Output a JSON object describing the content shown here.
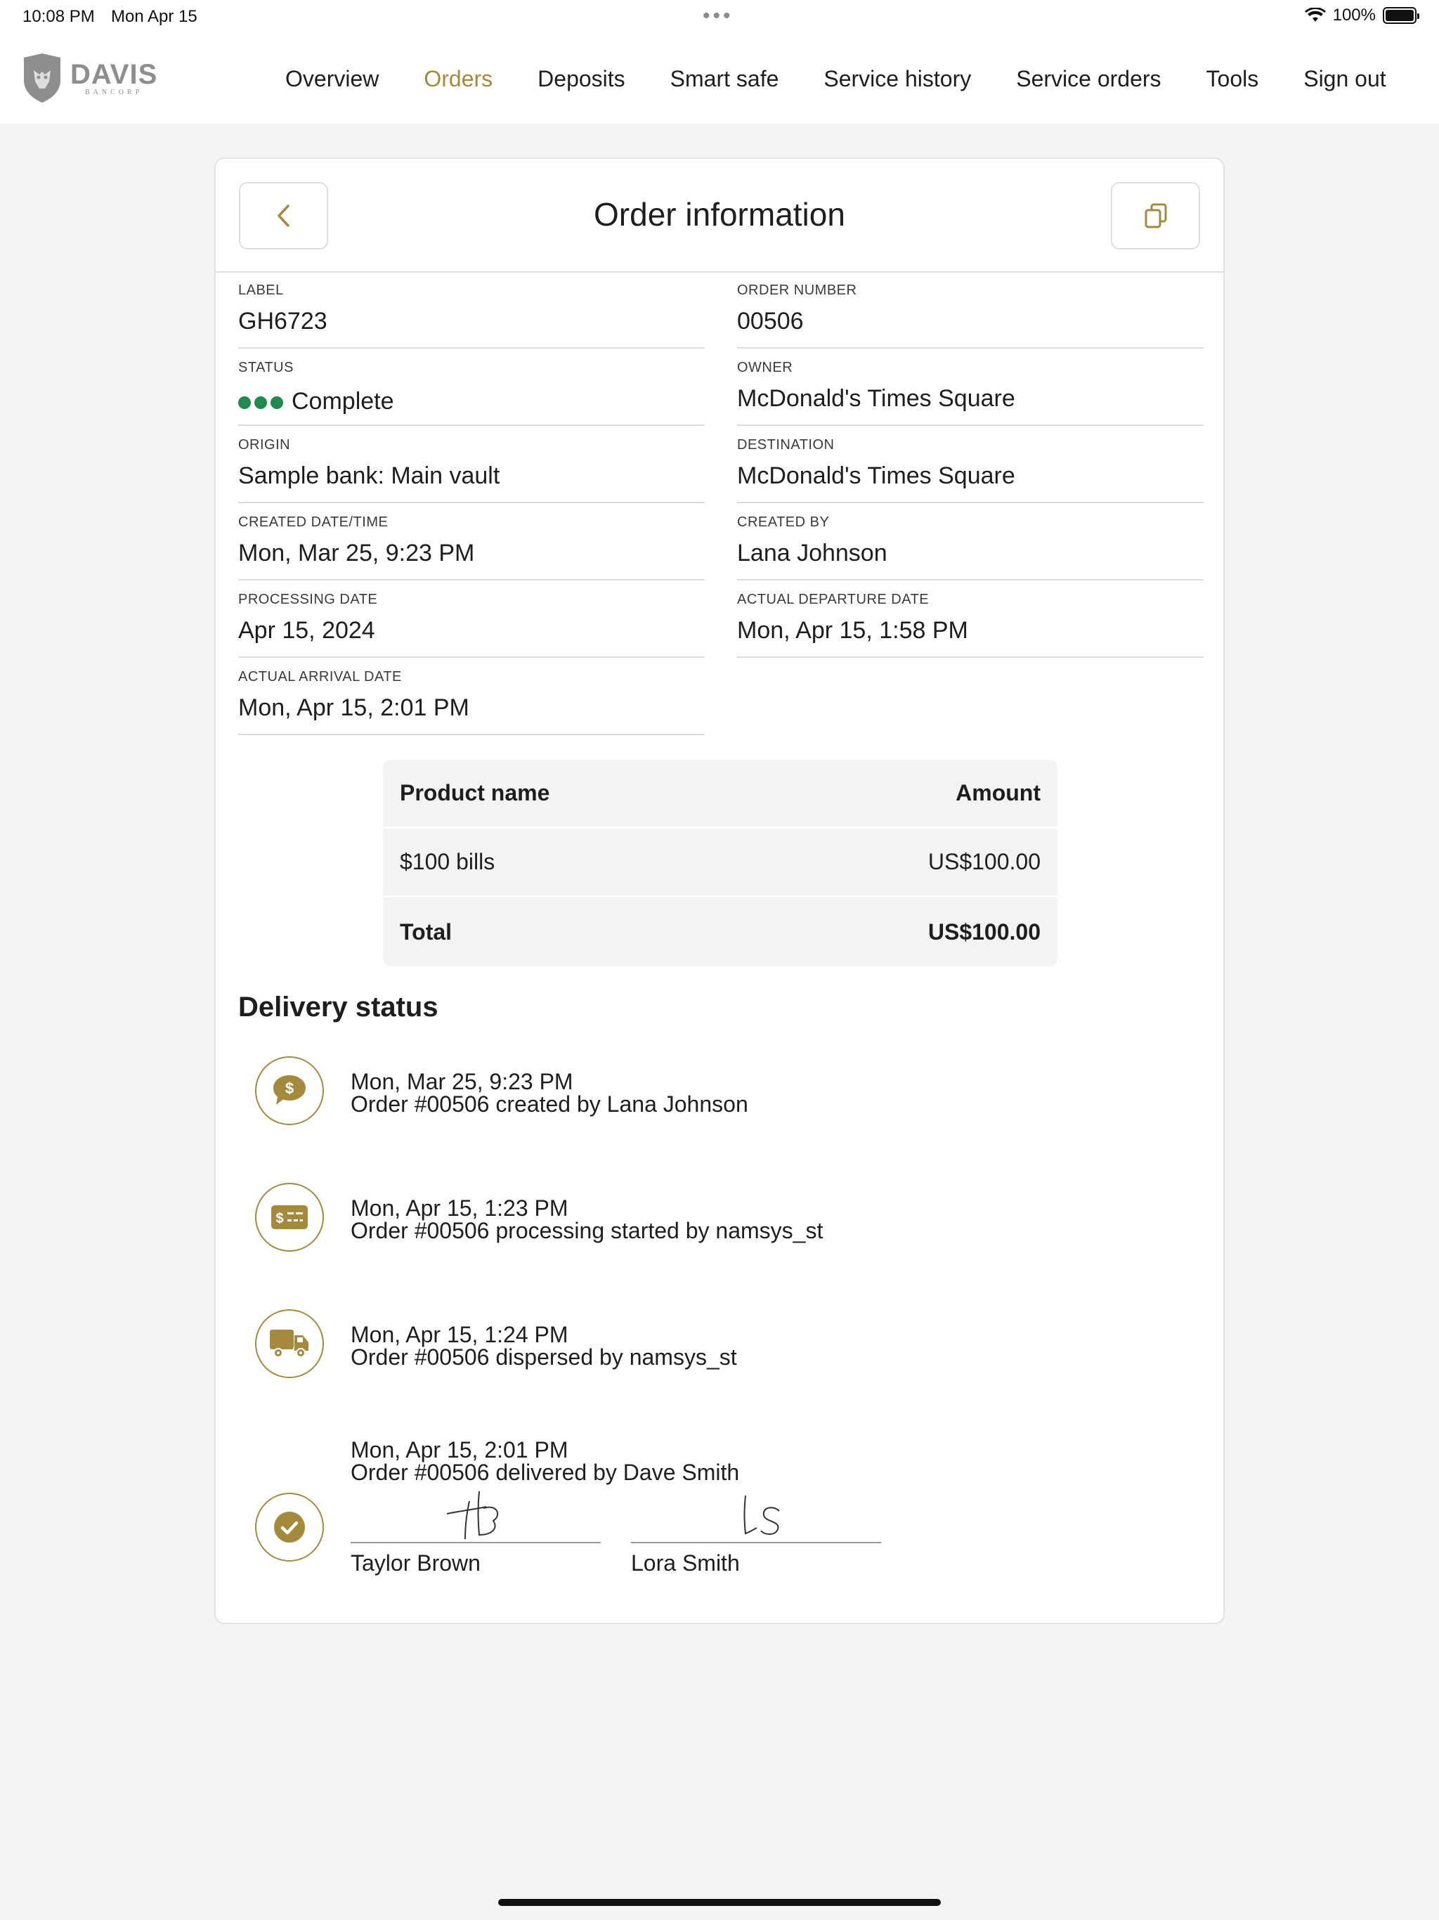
{
  "status_bar": {
    "time": "10:08 PM",
    "date": "Mon Apr 15",
    "battery": "100%"
  },
  "brand": {
    "name": "DAVIS",
    "sub": "BANCORP"
  },
  "nav": {
    "items": [
      "Overview",
      "Orders",
      "Deposits",
      "Smart safe",
      "Service history",
      "Service orders",
      "Tools",
      "Sign out"
    ],
    "active": "Orders"
  },
  "colors": {
    "accent": "#a48a3d",
    "status_green": "#1f8a4c"
  },
  "order": {
    "title": "Order information",
    "fields": {
      "label": {
        "label": "LABEL",
        "value": "GH6723"
      },
      "order_number": {
        "label": "ORDER NUMBER",
        "value": "00506"
      },
      "status": {
        "label": "STATUS",
        "value": "Complete"
      },
      "owner": {
        "label": "OWNER",
        "value": "McDonald's Times Square"
      },
      "origin": {
        "label": "ORIGIN",
        "value": "Sample bank: Main vault"
      },
      "destination": {
        "label": "DESTINATION",
        "value": "McDonald's Times Square"
      },
      "created_datetime": {
        "label": "CREATED DATE/TIME",
        "value": "Mon, Mar 25, 9:23 PM"
      },
      "created_by": {
        "label": "CREATED BY",
        "value": "Lana Johnson"
      },
      "processing_date": {
        "label": "PROCESSING DATE",
        "value": "Apr 15, 2024"
      },
      "actual_departure": {
        "label": "ACTUAL DEPARTURE DATE",
        "value": "Mon, Apr 15, 1:58 PM"
      },
      "actual_arrival": {
        "label": "ACTUAL ARRIVAL DATE",
        "value": "Mon, Apr 15, 2:01 PM"
      }
    }
  },
  "products": {
    "headers": {
      "name": "Product name",
      "amount": "Amount"
    },
    "rows": [
      {
        "name": "$100 bills",
        "amount": "US$100.00"
      }
    ],
    "total": {
      "label": "Total",
      "amount": "US$100.00"
    }
  },
  "delivery": {
    "title": "Delivery status",
    "events": [
      {
        "icon": "money-chat-icon",
        "date": "Mon, Mar 25, 9:23 PM",
        "text": "Order #00506 created by Lana Johnson"
      },
      {
        "icon": "cash-card-icon",
        "date": "Mon, Apr 15, 1:23 PM",
        "text": "Order #00506 processing started by namsys_st"
      },
      {
        "icon": "truck-icon",
        "date": "Mon, Apr 15, 1:24 PM",
        "text": "Order #00506 dispersed by namsys_st"
      },
      {
        "icon": "check-circle-icon",
        "date": "Mon, Apr 15, 2:01 PM",
        "text": "Order #00506 delivered by Dave Smith"
      }
    ],
    "signatures": [
      {
        "name": "Taylor Brown",
        "initials": "TB"
      },
      {
        "name": "Lora Smith",
        "initials": "LS"
      }
    ]
  }
}
